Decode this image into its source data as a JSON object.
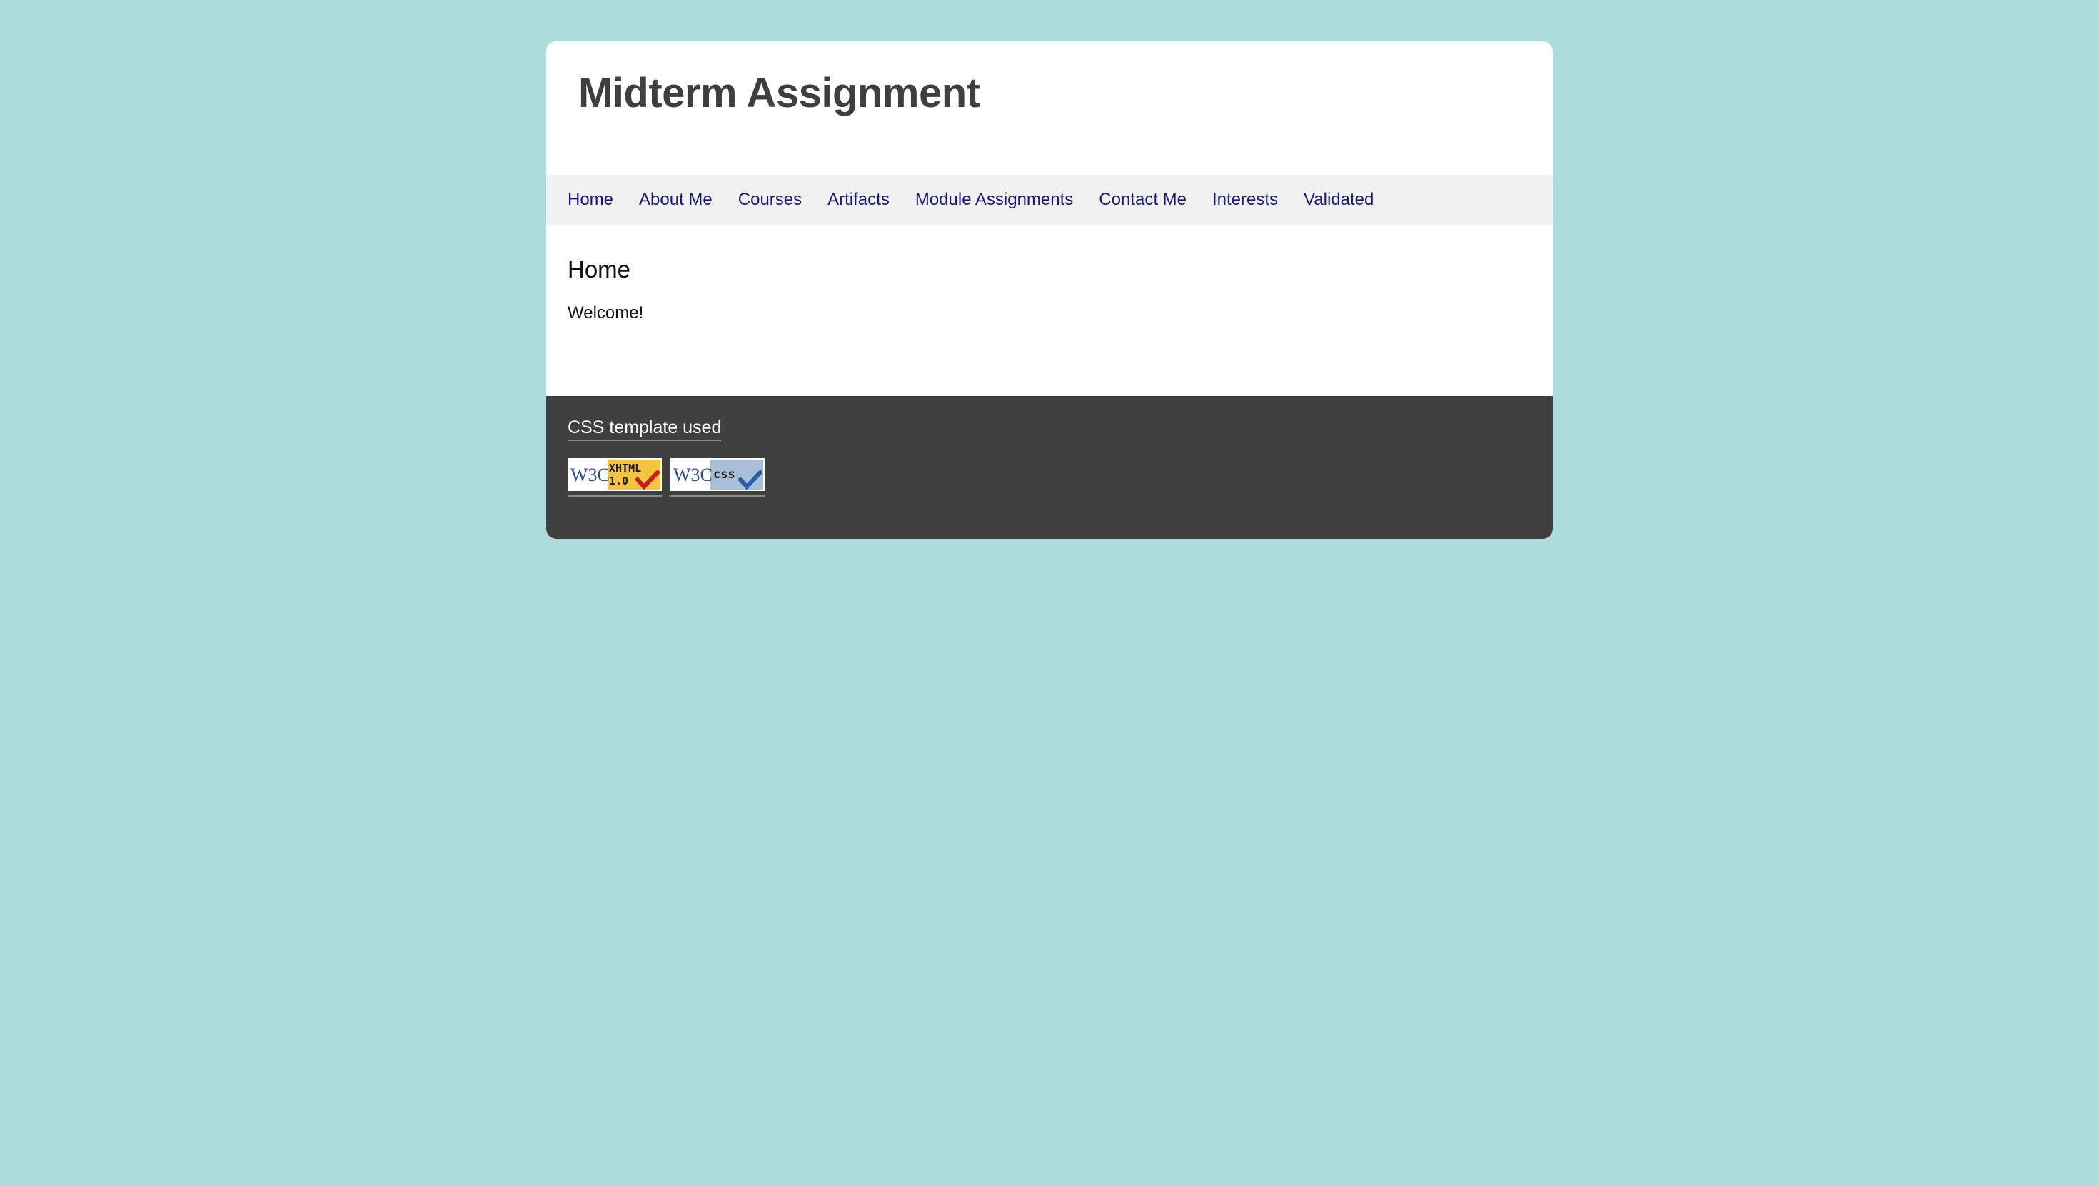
{
  "header": {
    "title": "Midterm Assignment"
  },
  "nav": {
    "items": [
      {
        "label": "Home"
      },
      {
        "label": "About Me"
      },
      {
        "label": "Courses"
      },
      {
        "label": "Artifacts"
      },
      {
        "label": "Module Assignments"
      },
      {
        "label": "Contact Me"
      },
      {
        "label": "Interests"
      },
      {
        "label": "Validated"
      }
    ]
  },
  "main": {
    "heading": "Home",
    "text": "Welcome!"
  },
  "footer": {
    "template_link": "CSS template used",
    "badges": [
      {
        "w3c": "W3C",
        "label_line1": "XHTML",
        "label_line2": "1.0",
        "icon": "w3c-xhtml-valid-icon",
        "accent": "#f6c343",
        "check": "#c41e1e"
      },
      {
        "w3c": "W3C",
        "label_line1": "css",
        "icon": "w3c-css-valid-icon",
        "accent": "#a9bfd8",
        "check": "#2a5fa6"
      }
    ]
  }
}
